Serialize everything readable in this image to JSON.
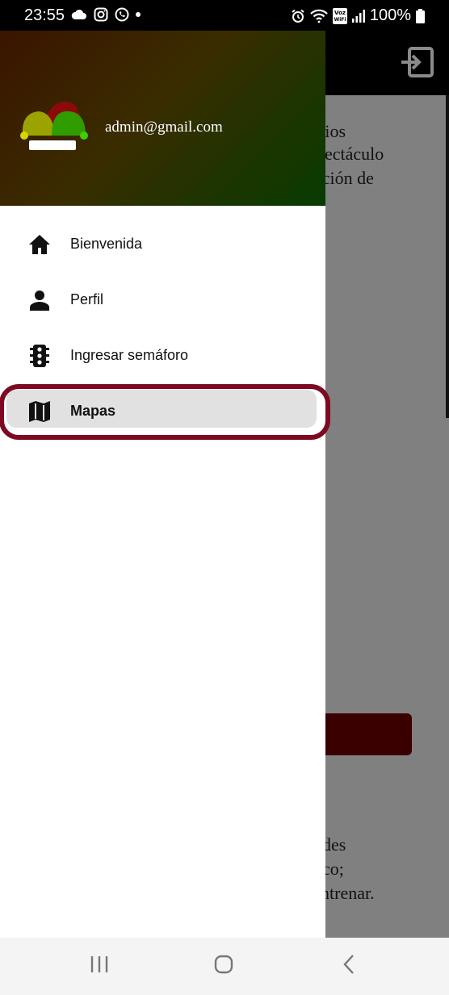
{
  "status_bar": {
    "time": "23:55",
    "battery": "100%",
    "icons": [
      "cloud-icon",
      "instagram-icon",
      "whatsapp-icon",
      "dot-icon",
      "alarm-icon",
      "wifi-icon",
      "vowifi-icon",
      "signal-icon",
      "battery-icon"
    ]
  },
  "drawer": {
    "email": "admin@gmail.com",
    "items": [
      {
        "label": "Bienvenida",
        "icon": "home-icon",
        "active": false
      },
      {
        "label": "Perfil",
        "icon": "person-icon",
        "active": false
      },
      {
        "label": "Ingresar semáforo",
        "icon": "traffic-light-icon",
        "active": false
      },
      {
        "label": "Mapas",
        "icon": "map-icon",
        "active": true
      }
    ],
    "colors": {
      "highlight": "#7d0a22",
      "active_bg": "#e1e1e1"
    }
  },
  "background": {
    "lines_top": [
      "rios",
      "pectáculo",
      "ación de"
    ],
    "lines_bottom": [
      "des",
      "co;",
      "ntrenar."
    ]
  },
  "nav_bar": {
    "icons": [
      "recent-apps-icon",
      "home-button-icon",
      "back-icon"
    ]
  }
}
